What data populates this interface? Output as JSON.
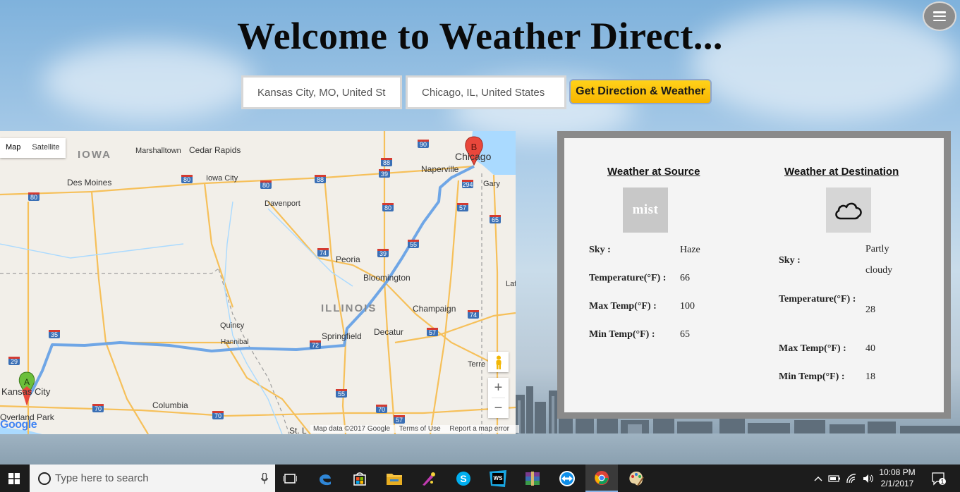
{
  "header": {
    "title": "Welcome to Weather Direct...",
    "source_value": "Kansas City, MO, United States",
    "destination_value": "Chicago, IL, United States",
    "submit_label": "Get Direction & Weather"
  },
  "map": {
    "type_controls": [
      "Map",
      "Satellite"
    ],
    "place_labels": [
      "IOWA",
      "Marshalltown",
      "Cedar Rapids",
      "Des Moines",
      "Iowa City",
      "Davenport",
      "Naperville",
      "Chicago",
      "Gary",
      "Peoria",
      "Bloomington",
      "ILLINOIS",
      "Champaign",
      "Quincy",
      "Hannibal",
      "Springfield",
      "Decatur",
      "Terre H",
      "Kansas City",
      "Overland Park",
      "Columbia",
      "St. L",
      "Laf"
    ],
    "highway_shields": [
      "80",
      "80",
      "80",
      "88",
      "90",
      "88",
      "39",
      "294",
      "80",
      "57",
      "65",
      "74",
      "39",
      "55",
      "74",
      "35",
      "72",
      "57",
      "29",
      "55",
      "70",
      "70",
      "70",
      "57"
    ],
    "marker_a": "A",
    "marker_b": "B",
    "zoom_in": "+",
    "zoom_out": "−",
    "attribution": [
      "Map data ©2017 Google",
      "Terms of Use",
      "Report a map error"
    ],
    "logo": "Google"
  },
  "weather": {
    "source": {
      "heading": "Weather at Source",
      "icon": "mist-icon",
      "icon_text": "mist",
      "sky_label": "Sky :",
      "sky": "Haze",
      "temp_label": "Temperature(°F) :",
      "temp": "66",
      "max_label": "Max Temp(°F) :",
      "max": "100",
      "min_label": "Min Temp(°F) :",
      "min": "65"
    },
    "destination": {
      "heading": "Weather at Destination",
      "icon": "cloud-icon",
      "sky_label": "Sky :",
      "sky": "Partly cloudy",
      "temp_label": "Temperature(°F) :",
      "temp": "28",
      "max_label": "Max Temp(°F) :",
      "max": "40",
      "min_label": "Min Temp(°F) :",
      "min": "18"
    }
  },
  "taskbar": {
    "search_placeholder": "Type here to search",
    "apps": [
      "task-view-icon",
      "edge-icon",
      "store-icon",
      "file-explorer-icon",
      "paint-icon",
      "skype-icon",
      "webstorm-icon",
      "winrar-icon",
      "teamviewer-icon",
      "chrome-icon",
      "paint-palette-icon"
    ],
    "time": "10:08 PM",
    "date": "2/1/2017",
    "notifications": "1"
  }
}
